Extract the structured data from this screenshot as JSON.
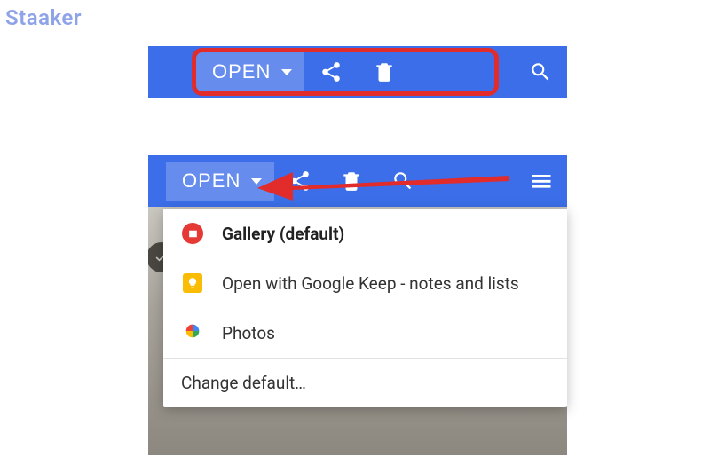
{
  "watermark": "Staaker",
  "toolbar": {
    "open_label": "OPEN"
  },
  "dropdown": {
    "items": [
      {
        "label": "Gallery (default)"
      },
      {
        "label": "Open with Google Keep - notes and lists"
      },
      {
        "label": "Photos"
      }
    ],
    "change_default": "Change default…"
  }
}
